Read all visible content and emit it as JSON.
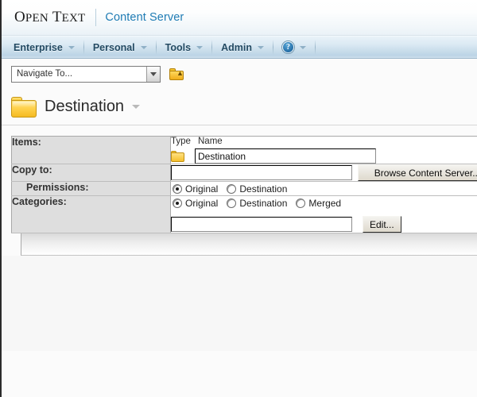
{
  "brand": {
    "open_word": "Open",
    "text_word": "Text",
    "open_full": "OPEN TEXT",
    "product": "Content Server"
  },
  "menu": {
    "items": [
      {
        "label": "Enterprise",
        "icon": "chevron-down-icon"
      },
      {
        "label": "Personal",
        "icon": "chevron-down-icon"
      },
      {
        "label": "Tools",
        "icon": "chevron-down-icon"
      },
      {
        "label": "Admin",
        "icon": "chevron-down-icon"
      }
    ],
    "help": {
      "glyph": "?",
      "icon": "help-circle-icon",
      "chevron": "chevron-down-icon"
    }
  },
  "navigate": {
    "selected": "Navigate To...",
    "dropdown_icon": "chevron-down-icon",
    "up_folder_icon": "folder-up-icon"
  },
  "page": {
    "title": "Destination",
    "folder_icon": "folder-icon",
    "menu_icon": "chevron-down-icon"
  },
  "form": {
    "rows": {
      "items": {
        "label": "Items:",
        "columns": {
          "type": "Type",
          "name": "Name"
        },
        "item": {
          "icon": "folder-icon",
          "name_value": "Destination"
        }
      },
      "copy_to": {
        "label": "Copy to:",
        "value": "",
        "browse_button": "Browse Content Server..."
      },
      "permissions": {
        "label": "Permissions:",
        "options": [
          {
            "label": "Original",
            "selected": true
          },
          {
            "label": "Destination",
            "selected": false
          }
        ]
      },
      "categories": {
        "label": "Categories:",
        "options": [
          {
            "label": "Original",
            "selected": true
          },
          {
            "label": "Destination",
            "selected": false
          },
          {
            "label": "Merged",
            "selected": false
          }
        ],
        "value": "",
        "edit_button": "Edit..."
      }
    }
  },
  "colors": {
    "brand_blue": "#1f7cb4",
    "menu_text": "#234a63",
    "label_bg": "#dedede",
    "folder_yellow": "#f5bb22",
    "page_bg": "#fbfbfb"
  }
}
